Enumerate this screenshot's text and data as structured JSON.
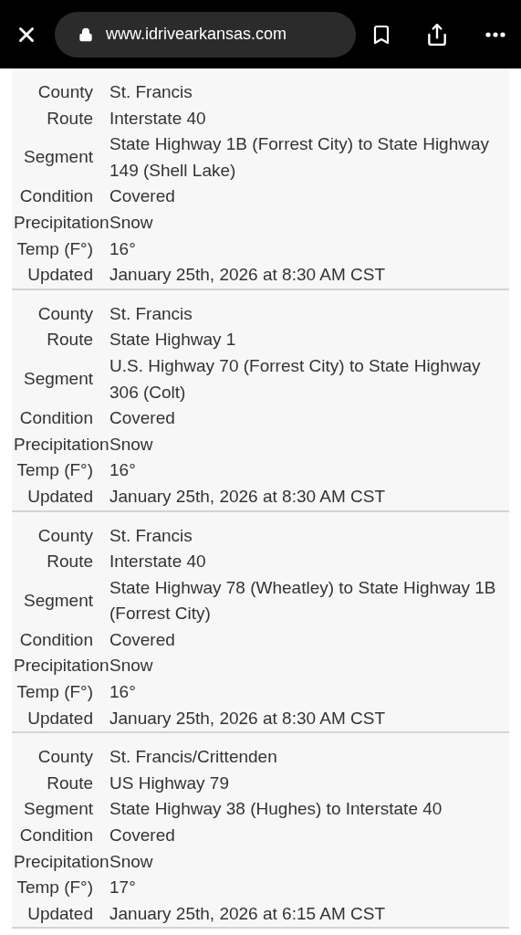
{
  "browser": {
    "url": "www.idrivearkansas.com"
  },
  "records": [
    {
      "fields": [
        {
          "label": "County",
          "value": "St. Francis"
        },
        {
          "label": "Route",
          "value": "Interstate 40"
        },
        {
          "label": "Segment",
          "value": "State Highway 1B (Forrest City) to State Highway 149 (Shell Lake)"
        },
        {
          "label": "Condition",
          "value": "Covered"
        },
        {
          "label": "Precipitation",
          "value": "Snow"
        },
        {
          "label": "Temp (F°)",
          "value": "16°"
        },
        {
          "label": "Updated",
          "value": "January 25th, 2026 at 8:30 AM CST"
        }
      ]
    },
    {
      "fields": [
        {
          "label": "County",
          "value": "St. Francis"
        },
        {
          "label": "Route",
          "value": "State Highway 1"
        },
        {
          "label": "Segment",
          "value": "U.S. Highway 70 (Forrest City) to State Highway 306 (Colt)"
        },
        {
          "label": "Condition",
          "value": "Covered"
        },
        {
          "label": "Precipitation",
          "value": "Snow"
        },
        {
          "label": "Temp (F°)",
          "value": "16°"
        },
        {
          "label": "Updated",
          "value": "January 25th, 2026 at 8:30 AM CST"
        }
      ]
    },
    {
      "fields": [
        {
          "label": "County",
          "value": "St. Francis"
        },
        {
          "label": "Route",
          "value": "Interstate 40"
        },
        {
          "label": "Segment",
          "value": "State Highway 78 (Wheatley) to State Highway 1B (Forrest City)"
        },
        {
          "label": "Condition",
          "value": "Covered"
        },
        {
          "label": "Precipitation",
          "value": "Snow"
        },
        {
          "label": "Temp (F°)",
          "value": "16°"
        },
        {
          "label": "Updated",
          "value": "January 25th, 2026 at 8:30 AM CST"
        }
      ]
    },
    {
      "fields": [
        {
          "label": "County",
          "value": "St. Francis/Crittenden"
        },
        {
          "label": "Route",
          "value": "US Highway 79"
        },
        {
          "label": "Segment",
          "value": "State Highway 38 (Hughes) to Interstate 40"
        },
        {
          "label": "Condition",
          "value": "Covered"
        },
        {
          "label": "Precipitation",
          "value": "Snow"
        },
        {
          "label": "Temp (F°)",
          "value": "17°"
        },
        {
          "label": "Updated",
          "value": "January 25th, 2026 at 6:15 AM CST"
        }
      ]
    }
  ]
}
